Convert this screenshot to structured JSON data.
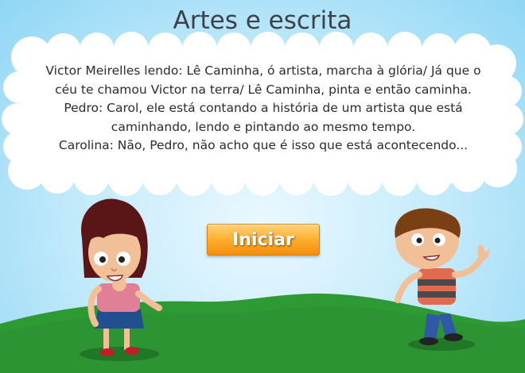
{
  "title": "Artes e escrita",
  "dialogue": [
    "Victor Meirelles lendo: Lê Caminha, ó artista, marcha à glória/ Já que o",
    "céu te chamou Victor na terra/ Lê Caminha, pinta e então caminha.",
    "Pedro: Carol, ele está contando a história de um artista que está",
    "caminhando, lendo e pintando ao mesmo tempo.",
    "Carolina: Não, Pedro, não acho que é isso que está acontecendo..."
  ],
  "start_button": {
    "label": "Iniciar"
  },
  "colors": {
    "sky": "#8fd6f5",
    "grass": "#2e9a34",
    "button": "#f7a21e",
    "title_text": "#3d4148"
  }
}
